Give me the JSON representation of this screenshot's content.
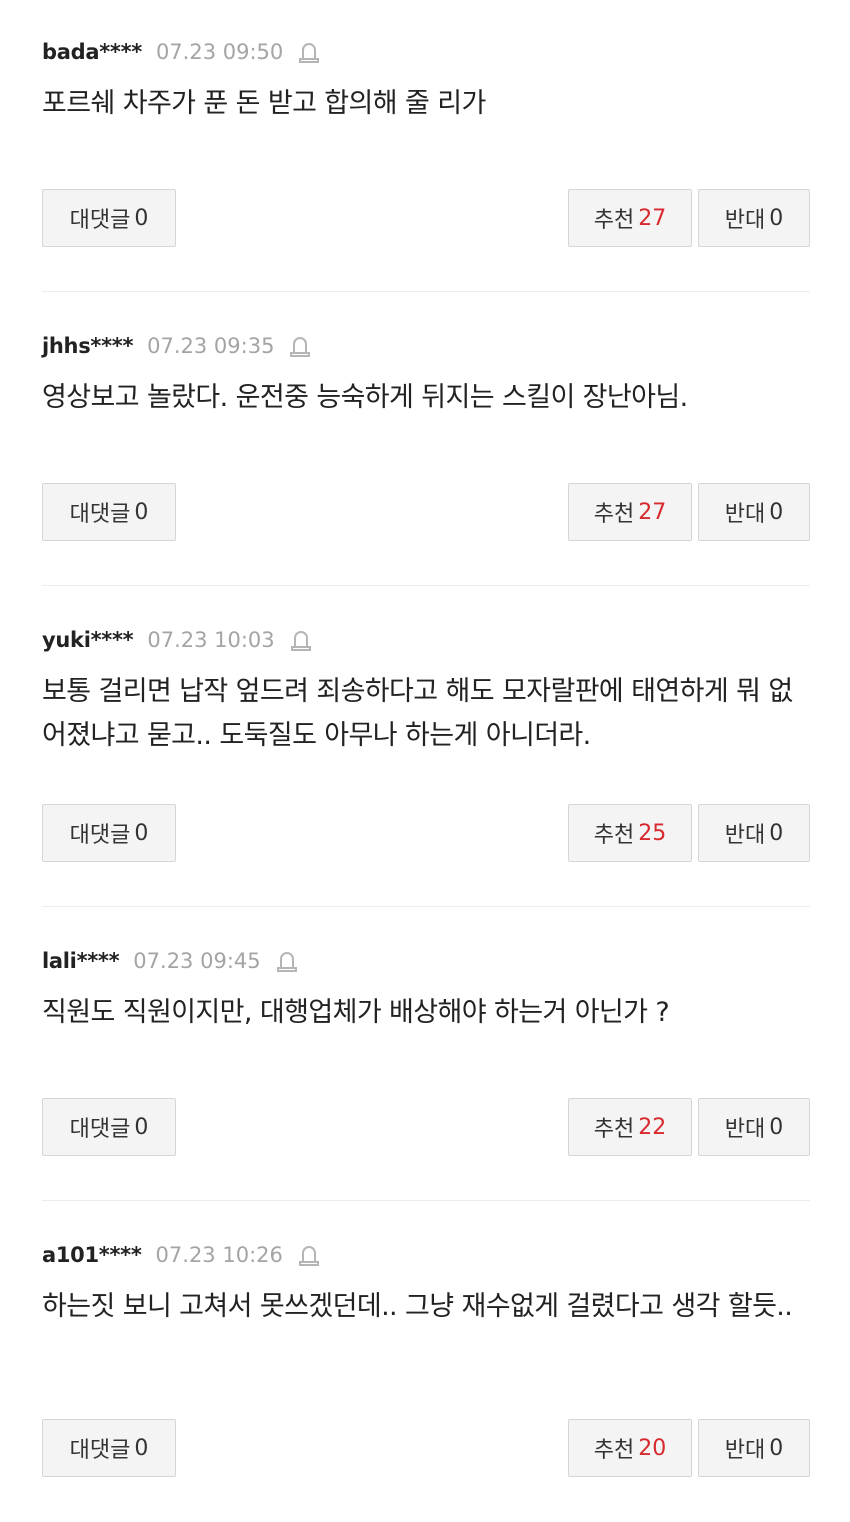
{
  "comments": [
    {
      "user": "bada****",
      "time": "07.23 09:50",
      "text": "포르쉐 차주가 푼 돈 받고 합의해 줄 리가",
      "reply_label": "대댓글",
      "reply_count": "0",
      "like_label": "추천",
      "like_count": "27",
      "dislike_label": "반대",
      "dislike_count": "0"
    },
    {
      "user": "jhhs****",
      "time": "07.23 09:35",
      "text": "영상보고 놀랐다. 운전중 능숙하게 뒤지는 스킬이 장난아님.",
      "reply_label": "대댓글",
      "reply_count": "0",
      "like_label": "추천",
      "like_count": "27",
      "dislike_label": "반대",
      "dislike_count": "0"
    },
    {
      "user": "yuki****",
      "time": "07.23 10:03",
      "text": "보통 걸리면 납작 엎드려 죄송하다고 해도 모자랄판에 태연하게 뭐 없어졌냐고 묻고.. 도둑질도 아무나 하는게 아니더라.",
      "reply_label": "대댓글",
      "reply_count": "0",
      "like_label": "추천",
      "like_count": "25",
      "dislike_label": "반대",
      "dislike_count": "0"
    },
    {
      "user": "lali****",
      "time": "07.23 09:45",
      "text": "직원도 직원이지만, 대행업체가 배상해야 하는거 아닌가 ?",
      "reply_label": "대댓글",
      "reply_count": "0",
      "like_label": "추천",
      "like_count": "22",
      "dislike_label": "반대",
      "dislike_count": "0"
    },
    {
      "user": "a101****",
      "time": "07.23 10:26",
      "text": "하는짓 보니 고쳐서 못쓰겠던데.. 그냥 재수없게 걸렸다고 생각 할듯..",
      "reply_label": "대댓글",
      "reply_count": "0",
      "like_label": "추천",
      "like_count": "20",
      "dislike_label": "반대",
      "dislike_count": "0"
    }
  ],
  "icons": {
    "report": "siren-report-icon"
  },
  "colors": {
    "like_count": "#d8292f",
    "timestamp": "#a4a4a4",
    "button_bg": "#f4f4f4",
    "button_border": "#d6d6d6"
  }
}
